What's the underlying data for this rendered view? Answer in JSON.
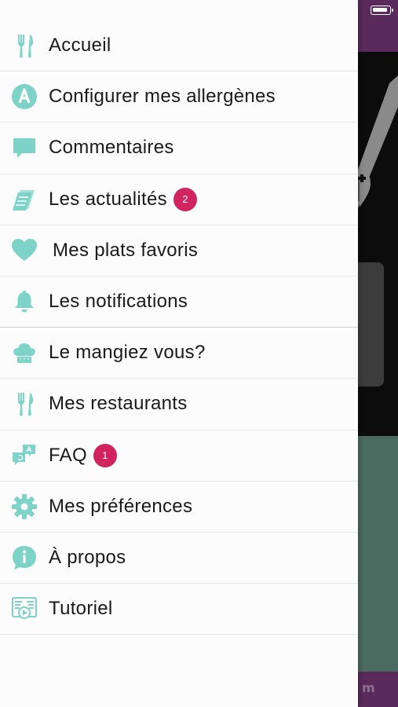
{
  "colors": {
    "accent": "#7dd3c8",
    "badge": "#d1245e",
    "backdrop_purple": "#5a2a5c",
    "backdrop_green": "#4b6a60"
  },
  "menu": {
    "items": [
      {
        "label": "Accueil",
        "icon": "fork-knife-icon"
      },
      {
        "label": "Configurer mes allergènes",
        "icon": "allergen-a-icon"
      },
      {
        "label": "Commentaires",
        "icon": "comment-bubble-icon"
      },
      {
        "label": "Les actualités",
        "icon": "newspaper-icon",
        "badge": "2"
      },
      {
        "label": "Mes plats favoris",
        "icon": "heart-icon"
      },
      {
        "label": "Les notifications",
        "icon": "bell-icon"
      },
      {
        "label": "Le mangiez vous?",
        "icon": "chef-hat-icon"
      },
      {
        "label": "Mes restaurants",
        "icon": "fork-knife-icon"
      },
      {
        "label": "FAQ",
        "icon": "faq-bubbles-icon",
        "badge": "1"
      },
      {
        "label": "Mes préférences",
        "icon": "gear-icon"
      },
      {
        "label": "À propos",
        "icon": "info-icon"
      },
      {
        "label": "Tutoriel",
        "icon": "tutorial-icon"
      }
    ]
  }
}
